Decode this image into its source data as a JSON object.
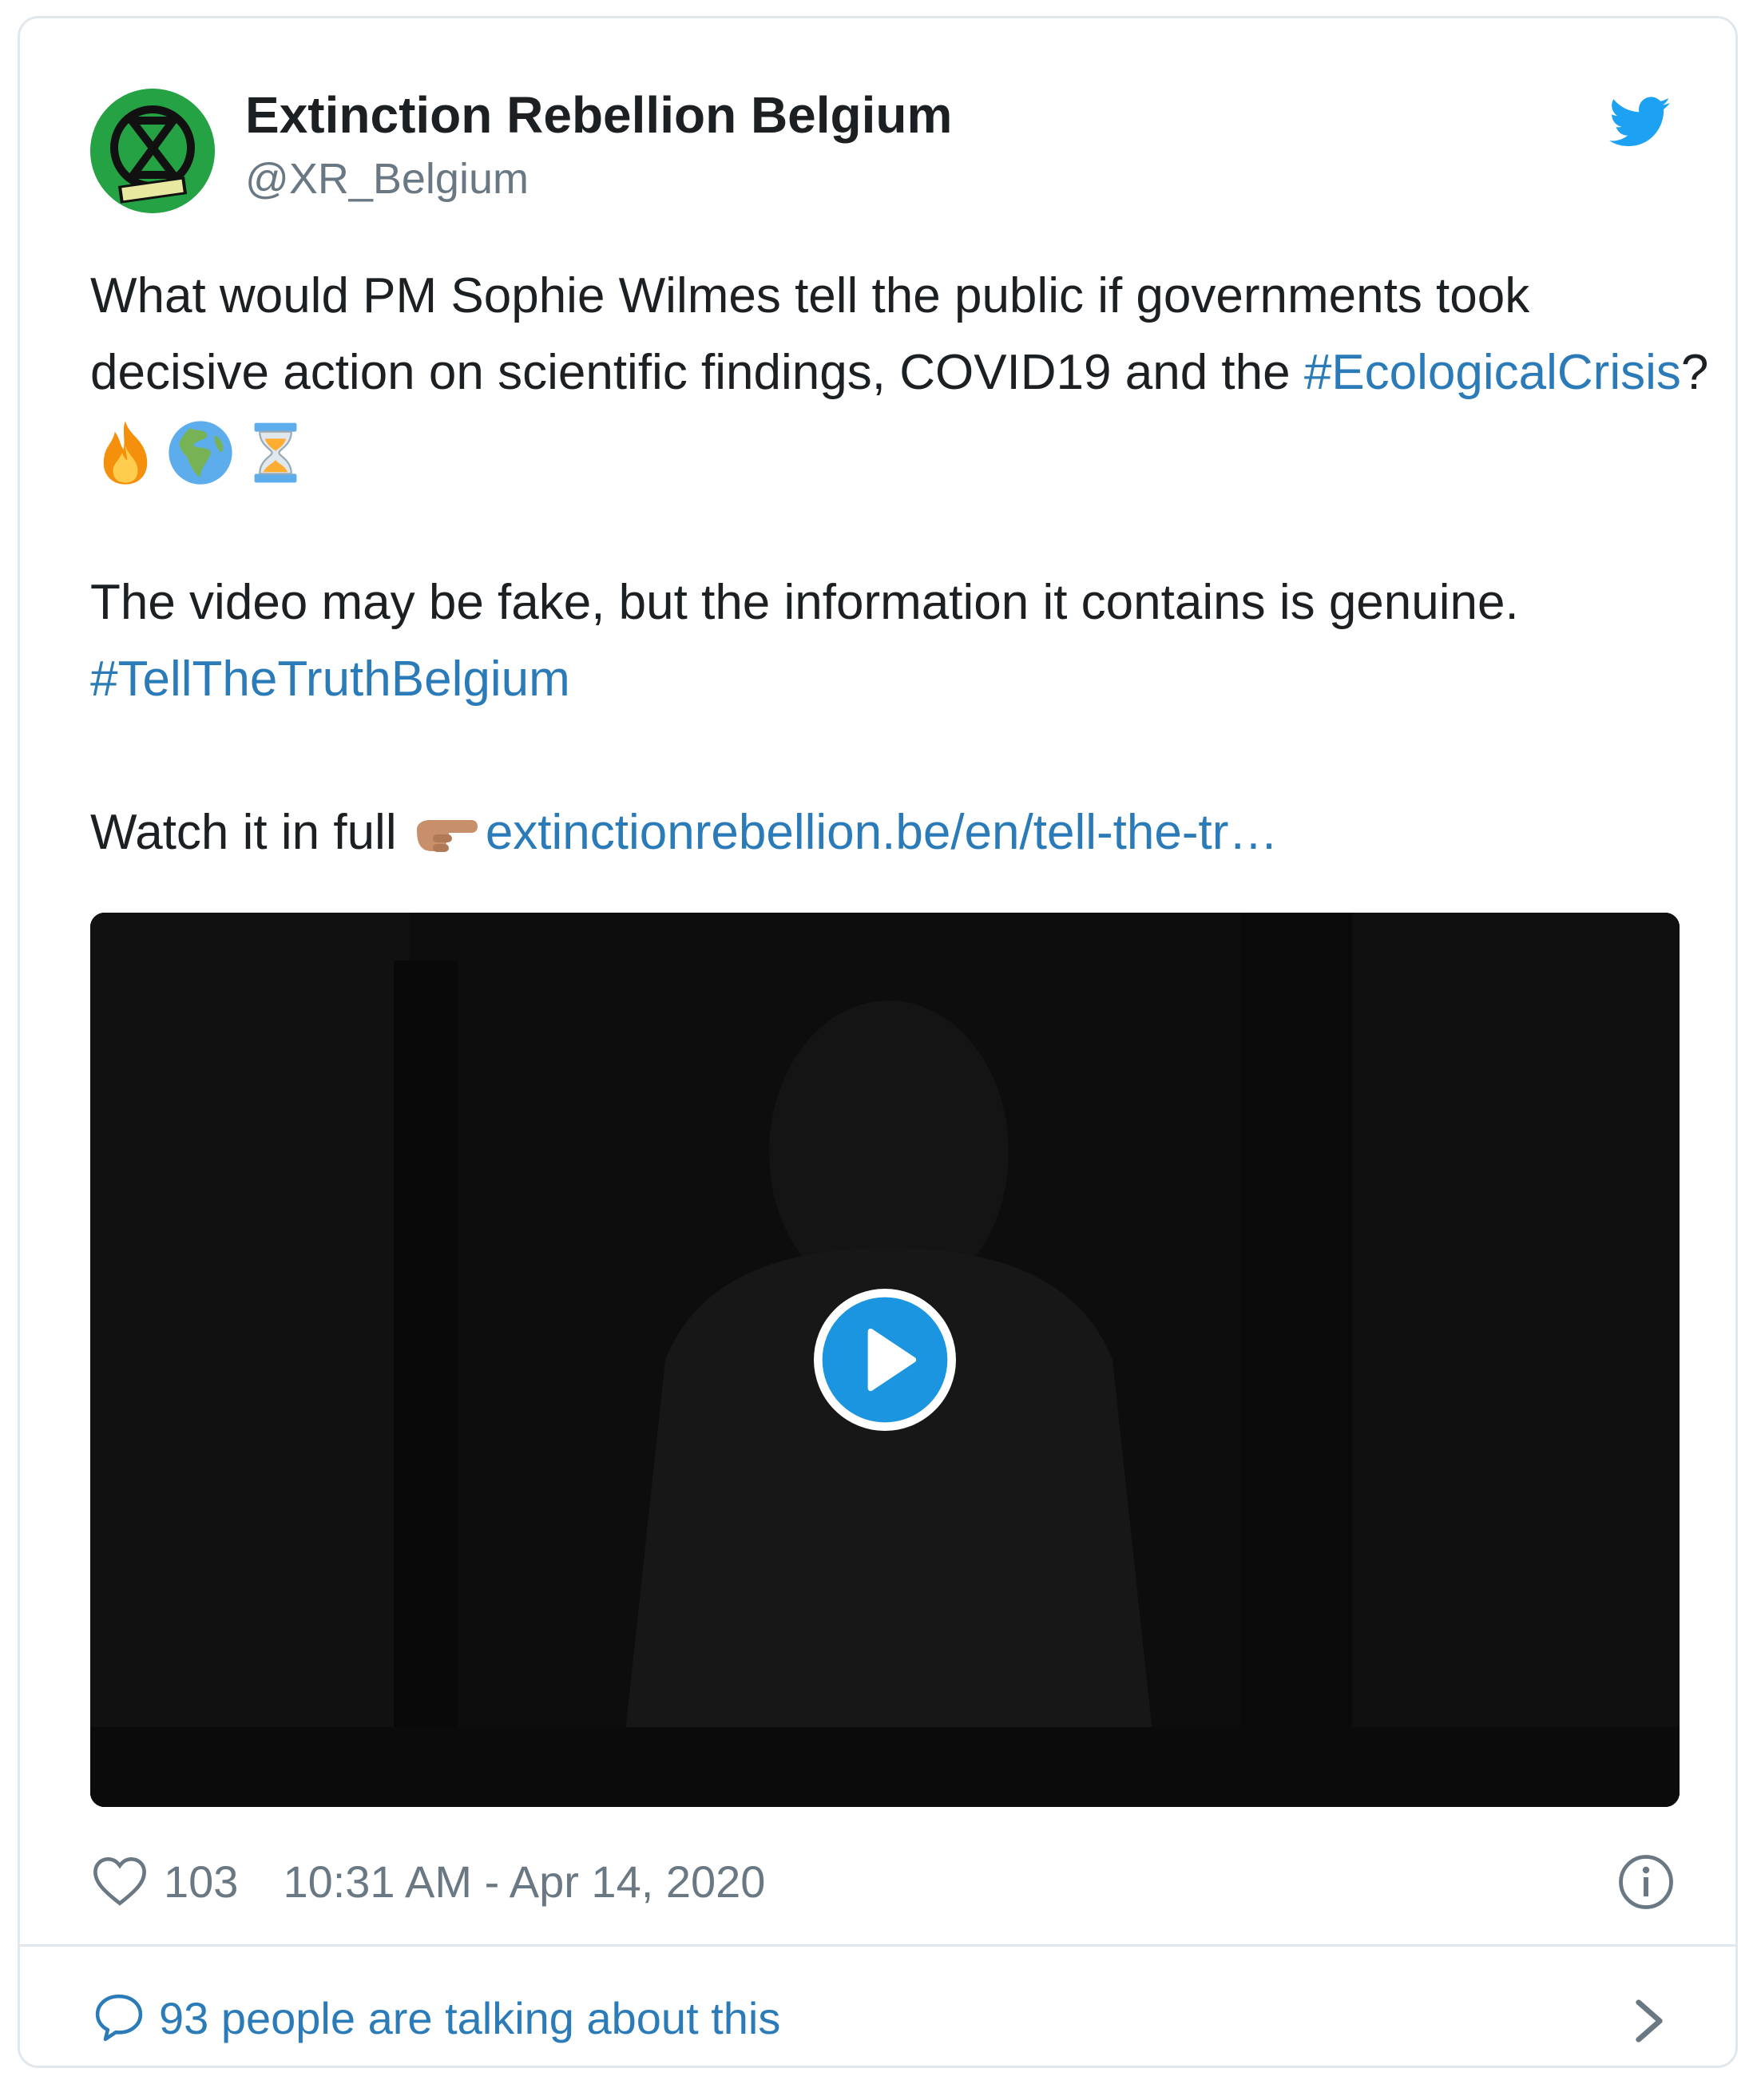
{
  "account": {
    "display_name": "Extinction Rebellion Belgium",
    "handle": "@XR_Belgium",
    "avatar_badge": "BELGIUM"
  },
  "tweet": {
    "line1": "What would PM Sophie Wilmes tell the public if governments took decisive action on scientific findings, COVID19 and the ",
    "hashtag1": "#EcologicalCrisis",
    "after_hashtag1": "? ",
    "emojis1": [
      "fire-emoji",
      "globe-europe-africa-emoji",
      "hourglass-emoji"
    ],
    "line2": "The video may be fake, but the information it contains is genuine. ",
    "hashtag2": "#TellTheTruthBelgium",
    "line3": "Watch it in full ",
    "emoji3": "pointing-right-emoji",
    "url": "extinctionrebellion.be/en/tell-the-tr…"
  },
  "footer": {
    "likes": "103",
    "timestamp": "10:31 AM - Apr 14, 2020",
    "talking": "93 people are talking about this"
  },
  "colors": {
    "link": "#2b7bb9",
    "muted": "#697882",
    "twitter_blue": "#1da1f2",
    "avatar_green": "#25a244"
  }
}
